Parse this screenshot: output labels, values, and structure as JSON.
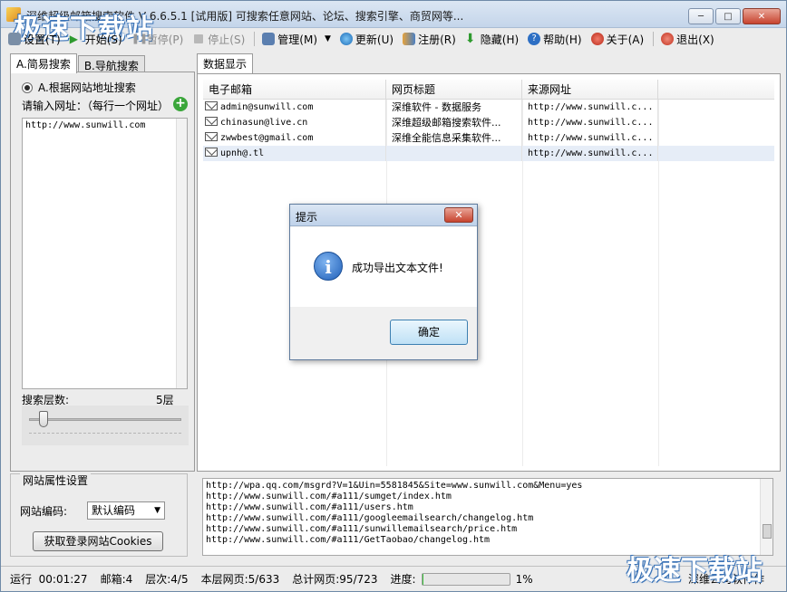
{
  "window": {
    "title": "深维超级邮箱搜索软件 V 6.6.5.1 [试用版] 可搜索任意网站、论坛、搜索引擎、商贸网等...",
    "controls": [
      "minimize",
      "maximize",
      "close"
    ]
  },
  "watermark": {
    "top": "极速下载站",
    "bottom": "极速下载站"
  },
  "toolbar": {
    "settings": "设置(T)",
    "start": "开始(S)",
    "pause": "暂停(P)",
    "stop": "停止(S)",
    "manage": "管理(M)",
    "update": "更新(U)",
    "register": "注册(R)",
    "hide": "隐藏(H)",
    "help": "帮助(H)",
    "about": "关于(A)",
    "exit": "退出(X)"
  },
  "left": {
    "tabs": [
      "A.简易搜索",
      "B.导航搜索"
    ],
    "radio_label": "A.根据网站地址搜索",
    "input_label": "请输入网址：（每行一个网址）",
    "url_value": "http://www.sunwill.com",
    "depth_label": "搜索层数:",
    "depth_value": "5层",
    "depth_slider_level": 5
  },
  "props": {
    "title": "网站属性设置",
    "encoding_label": "网站编码:",
    "encoding_value": "默认编码",
    "cookie_button": "获取登录网站Cookies"
  },
  "right": {
    "tab": "数据显示",
    "columns": [
      "电子邮箱",
      "网页标题",
      "来源网址"
    ],
    "rows": [
      {
        "email": "admin@sunwill.com",
        "title": "深维软件 - 数据服务",
        "source": "http://www.sunwill.c..."
      },
      {
        "email": "chinasun@live.cn",
        "title": "深维超级邮箱搜索软件...",
        "source": "http://www.sunwill.c..."
      },
      {
        "email": "zwwbest@gmail.com",
        "title": "深维全能信息采集软件...",
        "source": "http://www.sunwill.c..."
      },
      {
        "email": "upnh@.tl",
        "title": "",
        "source": "http://www.sunwill.c..."
      }
    ],
    "log": [
      "http://wpa.qq.com/msgrd?V=1&Uin=5581845&Site=www.sunwill.com&Menu=yes",
      "http://www.sunwill.com/#a111/sumget/index.htm",
      "http://www.sunwill.com/#a111/users.htm",
      "http://www.sunwill.com/#a111/googleemailsearch/changelog.htm",
      "http://www.sunwill.com/#a111/sunwillemailsearch/price.htm",
      "http://www.sunwill.com/#a111/GetTaobao/changelog.htm"
    ]
  },
  "status": {
    "running": "运行",
    "time": "00:01:27",
    "mailbox": "邮箱:4",
    "level": "层次:4/5",
    "page": "本层网页:5/633",
    "total": "总计网页:95/723",
    "progress_label": "进度:",
    "progress_percent": 1,
    "progress_text": "1%",
    "right_text": "深维公司软件作"
  },
  "dialog": {
    "title": "提示",
    "message": "成功导出文本文件!",
    "ok": "确定"
  },
  "colors": {
    "progress": "#3cc03c",
    "plus": "#3aa63a",
    "close": "#c7432e",
    "info": "#1f5fb8"
  }
}
